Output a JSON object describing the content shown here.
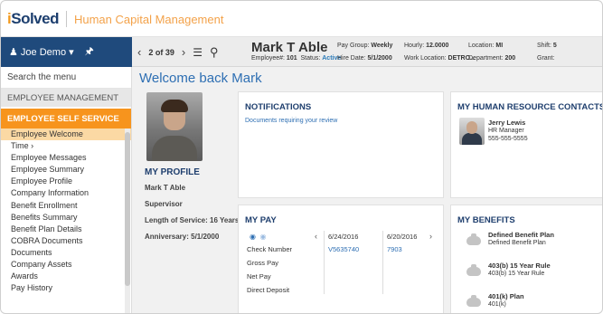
{
  "brand": {
    "logo_main": "iSolved",
    "logo_sub": "Human Capital Management"
  },
  "user": {
    "name": "Joe Demo"
  },
  "pager": {
    "count": "2 of 39"
  },
  "employee": {
    "name": "Mark T Able",
    "number_label": "Employee#:",
    "number": "101",
    "status_label": "Status:",
    "status": "Active",
    "pay_group_label": "Pay Group:",
    "pay_group": "Weekly",
    "hire_date_label": "Hire Date:",
    "hire_date": "5/1/2000",
    "hourly_label": "Hourly:",
    "hourly": "12.0000",
    "work_location_label": "Work Location:",
    "work_location": "DETRO...",
    "location_label": "Location:",
    "location": "MI",
    "department_label": "Department:",
    "department": "200",
    "shift_label": "Shift:",
    "shift": "5",
    "grant_label": "Grant:",
    "grant": ""
  },
  "sidebar": {
    "search": "Search the menu",
    "section_mgmt": "EMPLOYEE MANAGEMENT",
    "section_self": "EMPLOYEE SELF SERVICE",
    "items": [
      "Employee Welcome",
      "Time  ›",
      "Employee Messages",
      "Employee Summary",
      "Employee Profile",
      "Company Information",
      "Benefit Enrollment",
      "Benefits Summary",
      "Benefit Plan Details",
      "COBRA Documents",
      "Documents",
      "Company Assets",
      "Awards",
      "Pay History"
    ]
  },
  "main": {
    "welcome": "Welcome back Mark",
    "profile": {
      "title": "MY PROFILE",
      "name": "Mark T Able",
      "role": "Supervisor",
      "service": "Length of Service: 16 Years",
      "anniversary": "Anniversary: 5/1/2000"
    },
    "notifications": {
      "title": "NOTIFICATIONS",
      "link": "Documents requiring your review"
    },
    "hr": {
      "title": "MY HUMAN RESOURCE CONTACTS",
      "name": "Jerry Lewis",
      "role": "HR Manager",
      "phone": "555-555-5555"
    },
    "pay": {
      "title": "MY PAY",
      "rows": [
        "Check Number",
        "Gross Pay",
        "Net Pay",
        "Direct Deposit"
      ],
      "col1": {
        "date": "6/24/2016",
        "check": "V5635740"
      },
      "col2": {
        "date": "6/20/2016",
        "check": "7903"
      }
    },
    "benefits": {
      "title": "MY BENEFITS",
      "items": [
        {
          "name": "Defined Benefit Plan",
          "sub": "Defined Benefit Plan"
        },
        {
          "name": "403(b) 15 Year Rule",
          "sub": "403(b) 15 Year Rule"
        },
        {
          "name": "401(k) Plan",
          "sub": "401(k)"
        }
      ]
    }
  }
}
